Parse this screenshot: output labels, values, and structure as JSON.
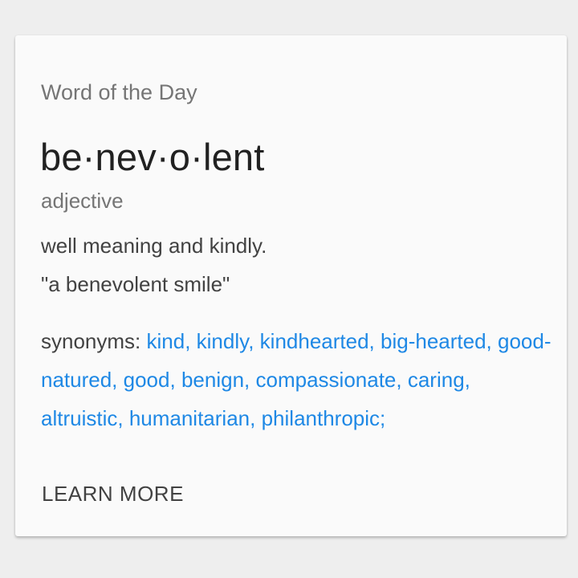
{
  "card": {
    "eyebrow": "Word of the Day",
    "word": "be·nev·o·lent",
    "part_of_speech": "adjective",
    "definition": "well meaning and kindly.",
    "example": "\"a benevolent smile\"",
    "synonyms_label": "synonyms: ",
    "synonyms": [
      "kind",
      "kindly",
      "kindhearted",
      "big-hearted",
      "good-natured",
      "good",
      "benign",
      "compassionate",
      "caring",
      "altruistic",
      "humanitarian",
      "philanthropic"
    ],
    "learn_more_label": "LEARN MORE"
  },
  "colors": {
    "background": "#eeeeee",
    "card": "#fafafa",
    "link": "#1e88e5",
    "primary_text": "#212121",
    "secondary_text": "#757575"
  }
}
